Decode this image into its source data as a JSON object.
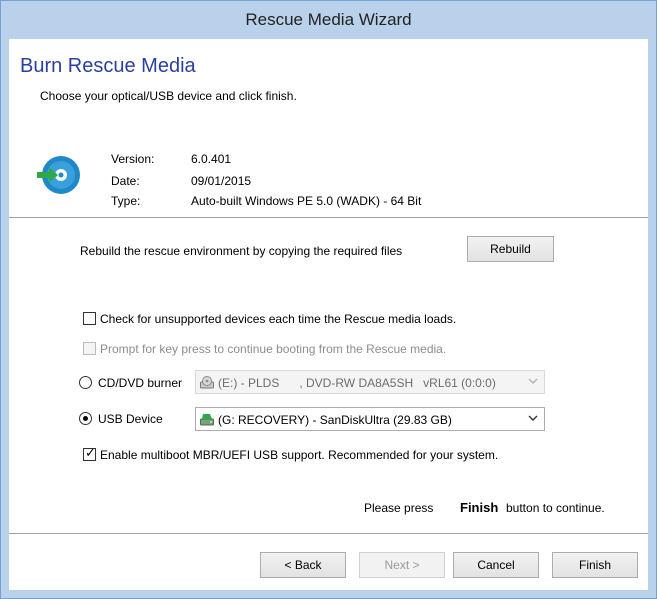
{
  "window": {
    "title": "Rescue Media Wizard"
  },
  "header": {
    "title": "Burn Rescue Media",
    "subtitle": "Choose your optical/USB device and click finish."
  },
  "info": {
    "version_label": "Version:",
    "version_value": "6.0.401",
    "date_label": "Date:",
    "date_value": "09/01/2015",
    "type_label": "Type:",
    "type_value": "Auto-built Windows PE 5.0 (WADK) - 64 Bit"
  },
  "rebuild": {
    "text": "Rebuild the rescue environment by copying the required files",
    "button_label": "Rebuild"
  },
  "options": {
    "check_unsupported": {
      "label": "Check for unsupported devices each time the Rescue media loads.",
      "checked": false
    },
    "prompt_keypress": {
      "label": "Prompt for key press to continue booting from the Rescue media.",
      "checked": false,
      "disabled": true
    },
    "cd_dvd": {
      "label": "CD/DVD burner",
      "selected": false,
      "device": "(E:) - PLDS      , DVD-RW DA8A5SH   vRL61 (0:0:0)"
    },
    "usb": {
      "label": "USB Device",
      "selected": true,
      "device": "(G: RECOVERY) - SanDiskUltra (29.83 GB)"
    },
    "multiboot": {
      "label": "Enable multiboot MBR/UEFI USB support. Recommended for your system.",
      "checked": true
    }
  },
  "finish_message": {
    "prefix": "Please press",
    "bold": "Finish",
    "suffix": "button to continue."
  },
  "footer": {
    "back_label": "< Back",
    "next_label": "Next >",
    "cancel_label": "Cancel",
    "finish_label": "Finish"
  },
  "icons": {
    "disc": "disc-arrow-icon",
    "optical_drive": "optical-drive-icon",
    "usb_drive": "usb-drive-icon",
    "dropdown": "chevron-down-icon"
  },
  "colors": {
    "accent": "#2a3f9f",
    "title_bar": "#b9d1ea",
    "disc_blue": "#1e88c8",
    "arrow_green": "#2ea84a"
  }
}
